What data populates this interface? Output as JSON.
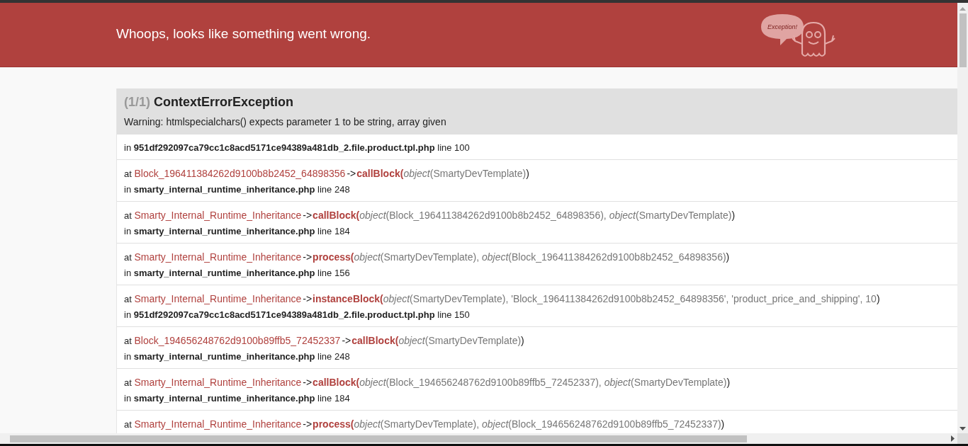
{
  "header": {
    "title": "Whoops, looks like something went wrong.",
    "bubble_text": "Exception!"
  },
  "exception": {
    "count": "(1/1)",
    "name": "ContextErrorException",
    "message": "Warning: htmlspecialchars() expects parameter 1 to be string, array given"
  },
  "trace": [
    {
      "prefix": "in",
      "file": "951df292097ca79cc1c8acd5171ce94389a481db_2.file.product.tpl.php",
      "line": "line 100"
    },
    {
      "prefix": "at",
      "class": "Block_196411384262d9100b8b2452_64898356",
      "arrow": "->",
      "method": "callBlock",
      "open": "(",
      "args": "*object*(SmartyDevTemplate)",
      "close": ")",
      "in": "in",
      "file": "smarty_internal_runtime_inheritance.php",
      "line": "line 248"
    },
    {
      "prefix": "at",
      "class": "Smarty_Internal_Runtime_Inheritance",
      "arrow": "->",
      "method": "callBlock",
      "open": "(",
      "args": "*object*(Block_196411384262d9100b8b2452_64898356), *object*(SmartyDevTemplate)",
      "close": ")",
      "in": "in",
      "file": "smarty_internal_runtime_inheritance.php",
      "line": "line 184"
    },
    {
      "prefix": "at",
      "class": "Smarty_Internal_Runtime_Inheritance",
      "arrow": "->",
      "method": "process",
      "open": "(",
      "args": "*object*(SmartyDevTemplate), *object*(Block_196411384262d9100b8b2452_64898356)",
      "close": ")",
      "in": "in",
      "file": "smarty_internal_runtime_inheritance.php",
      "line": "line 156"
    },
    {
      "prefix": "at",
      "class": "Smarty_Internal_Runtime_Inheritance",
      "arrow": "->",
      "method": "instanceBlock",
      "open": "(",
      "args": "*object*(SmartyDevTemplate), 'Block_196411384262d9100b8b2452_64898356', 'product_price_and_shipping', 10",
      "close": ")",
      "in": "in",
      "file": "951df292097ca79cc1c8acd5171ce94389a481db_2.file.product.tpl.php",
      "line": "line 150"
    },
    {
      "prefix": "at",
      "class": "Block_194656248762d9100b89ffb5_72452337",
      "arrow": "->",
      "method": "callBlock",
      "open": "(",
      "args": "*object*(SmartyDevTemplate)",
      "close": ")",
      "in": "in",
      "file": "smarty_internal_runtime_inheritance.php",
      "line": "line 248"
    },
    {
      "prefix": "at",
      "class": "Smarty_Internal_Runtime_Inheritance",
      "arrow": "->",
      "method": "callBlock",
      "open": "(",
      "args": "*object*(Block_194656248762d9100b89ffb5_72452337), *object*(SmartyDevTemplate)",
      "close": ")",
      "in": "in",
      "file": "smarty_internal_runtime_inheritance.php",
      "line": "line 184"
    },
    {
      "prefix": "at",
      "class": "Smarty_Internal_Runtime_Inheritance",
      "arrow": "->",
      "method": "process",
      "open": "(",
      "args": "*object*(SmartyDevTemplate), *object*(Block_194656248762d9100b89ffb5_72452337)",
      "close": ")"
    }
  ]
}
